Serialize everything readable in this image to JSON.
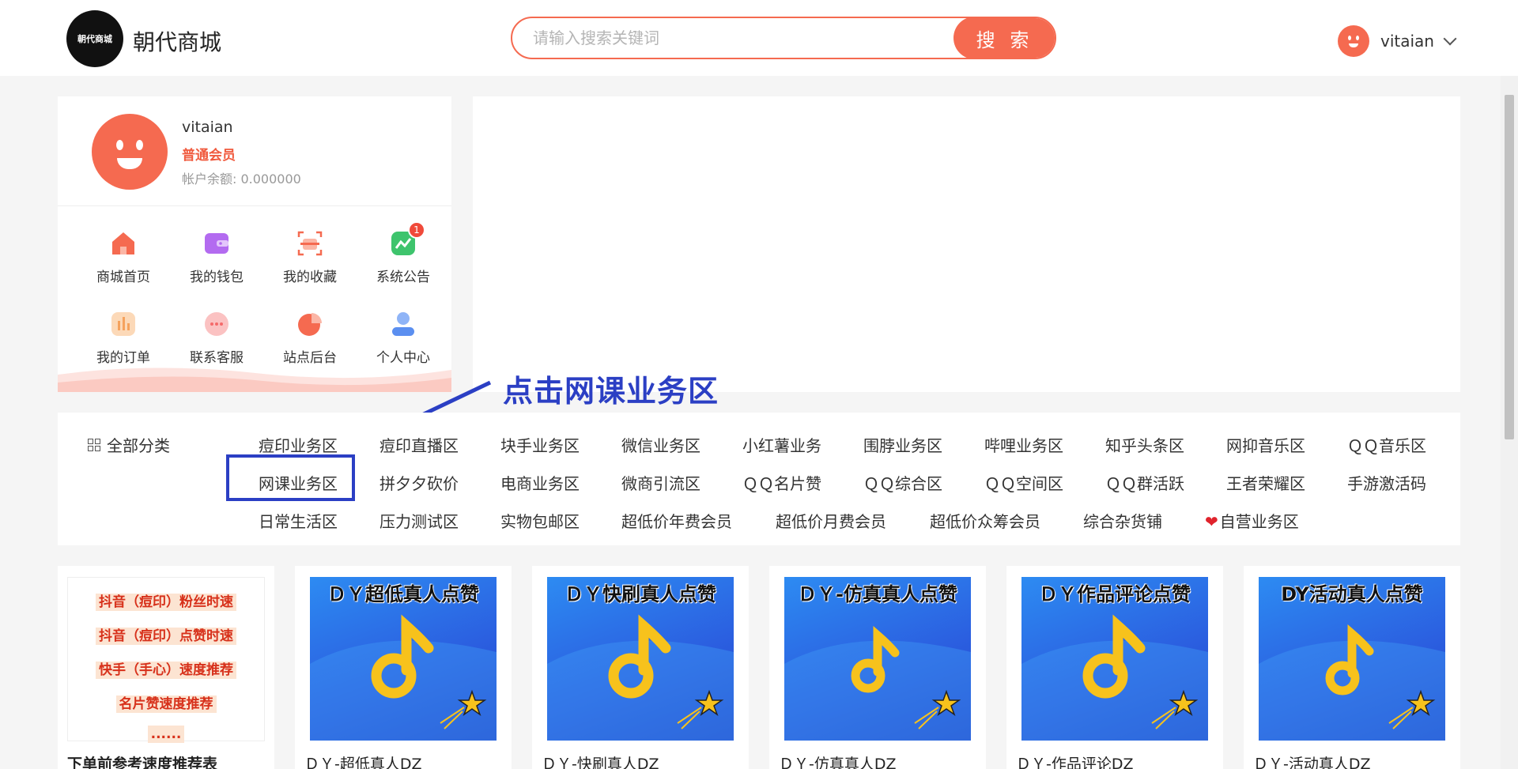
{
  "header": {
    "logo_text": "朝代商城",
    "site_name": "朝代商城",
    "search_placeholder": "请输入搜索关键词",
    "search_button": "搜 索",
    "username": "vitaian"
  },
  "profile": {
    "username": "vitaian",
    "level": "普通会员",
    "balance": "帐户余额: 0.000000",
    "quick_links": [
      {
        "label": "商城首页",
        "icon": "home-icon",
        "color": "#f56a50"
      },
      {
        "label": "我的钱包",
        "icon": "wallet-icon",
        "color": "#b36bf0"
      },
      {
        "label": "我的收藏",
        "icon": "favorites-icon",
        "color": "#f56a50"
      },
      {
        "label": "系统公告",
        "icon": "announcement-icon",
        "color": "#3ec46d",
        "badge": "1"
      },
      {
        "label": "我的订单",
        "icon": "orders-icon",
        "color": "#f5a25d"
      },
      {
        "label": "联系客服",
        "icon": "customer-service-icon",
        "color": "#f58a8a"
      },
      {
        "label": "站点后台",
        "icon": "site-admin-icon",
        "color": "#f56a50"
      },
      {
        "label": "个人中心",
        "icon": "user-center-icon",
        "color": "#5b8ff0"
      }
    ]
  },
  "annotation": {
    "text": "点击网课业务区"
  },
  "categories": {
    "all_label": "全部分类",
    "items": [
      "痘印业务区",
      "痘印直播区",
      "块手业务区",
      "微信业务区",
      "小红薯业务",
      "围脖业务区",
      "哔哩业务区",
      "知乎头条区",
      "网抑音乐区",
      "ＱＱ音乐区",
      "网课业务区",
      "拼夕夕砍价",
      "电商业务区",
      "微商引流区",
      "ＱＱ名片赞",
      "ＱＱ综合区",
      "ＱＱ空间区",
      "ＱＱ群活跃",
      "王者荣耀区",
      "手游激活码",
      "日常生活区",
      "压力测试区",
      "实物包邮区",
      "超低价年费会员",
      "超低价月费会员",
      "超低价众筹会员",
      "综合杂货铺",
      "自营业务区"
    ]
  },
  "products": {
    "speed_card": {
      "lines": [
        "抖音（痘印）粉丝时速",
        "抖音（痘印）点赞时速",
        "快手（手心）速度推荐",
        "名片赞速度推荐",
        "......"
      ],
      "caption": "下单前参考速度推荐表"
    },
    "items": [
      {
        "image_title": "ＤＹ超低真人点赞",
        "caption": "ＤＹ-超低真人DZ"
      },
      {
        "image_title": "ＤＹ快刷真人点赞",
        "caption": "ＤＹ-快刷真人DZ"
      },
      {
        "image_title": "ＤＹ-仿真真人点赞",
        "caption": "ＤＹ-仿真真人DZ"
      },
      {
        "image_title": "ＤＹ作品评论点赞",
        "caption": "ＤＹ-作品评论DZ"
      },
      {
        "image_title": "DY活动真人点赞",
        "caption": "ＤＹ-活动真人DZ"
      }
    ]
  },
  "colors": {
    "accent": "#f56a50",
    "annotation": "#2b3fc4",
    "level": "#f05a3e"
  }
}
